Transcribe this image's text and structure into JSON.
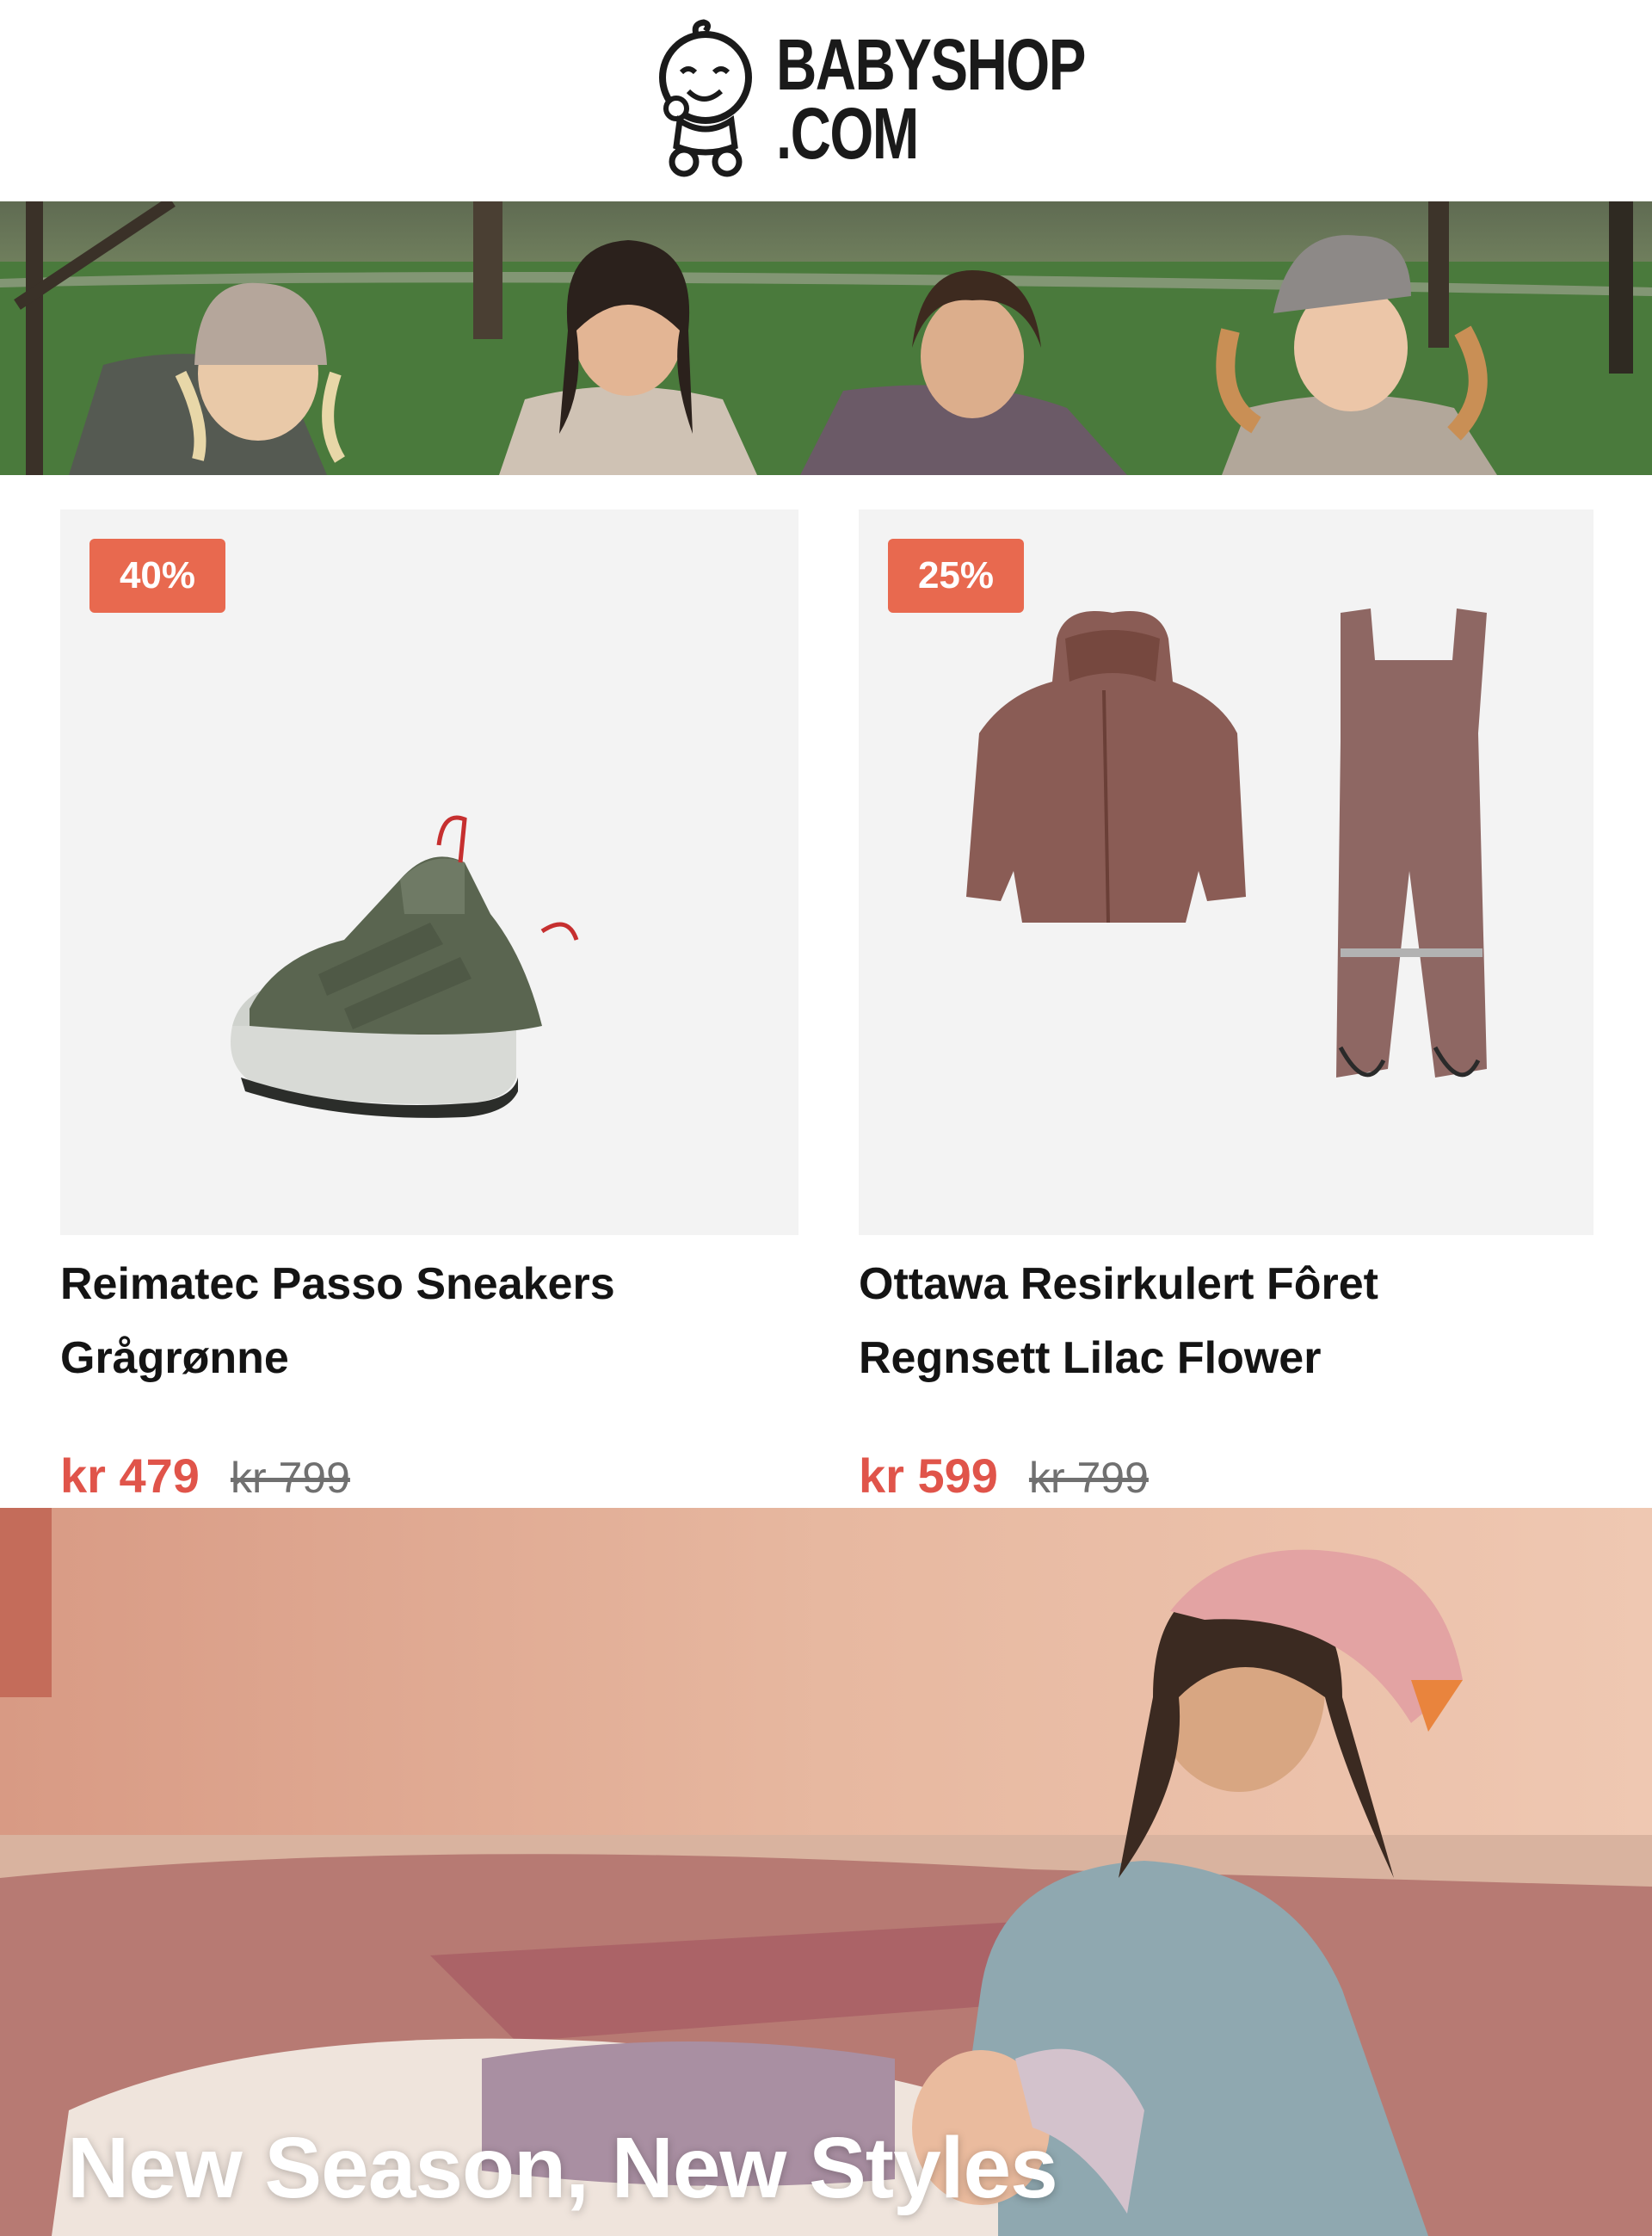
{
  "header": {
    "logo_line1": "BABYSHOP",
    "logo_line2": ".COM"
  },
  "hero": {
    "image": "hero-kids-running-photo"
  },
  "products": [
    {
      "name_line1": "Reimatec Passo Sneakers",
      "name_line2": "Grågrønne",
      "discount": "40%",
      "price": "kr 479",
      "old_price": "kr 799",
      "image": "green-sneaker-icon"
    },
    {
      "name_line1": "Ottawa Resirkulert Fôret",
      "name_line2": "Regnsett Lilac Flower",
      "discount": "25%",
      "price": "kr 599",
      "old_price": "kr 799",
      "image": "rain-set-icon"
    }
  ],
  "banner": {
    "title": "New Season, New Styles"
  },
  "colors": {
    "accent": "#e8694f",
    "sale_price": "#e0544a",
    "card_bg": "#f3f3f3"
  }
}
